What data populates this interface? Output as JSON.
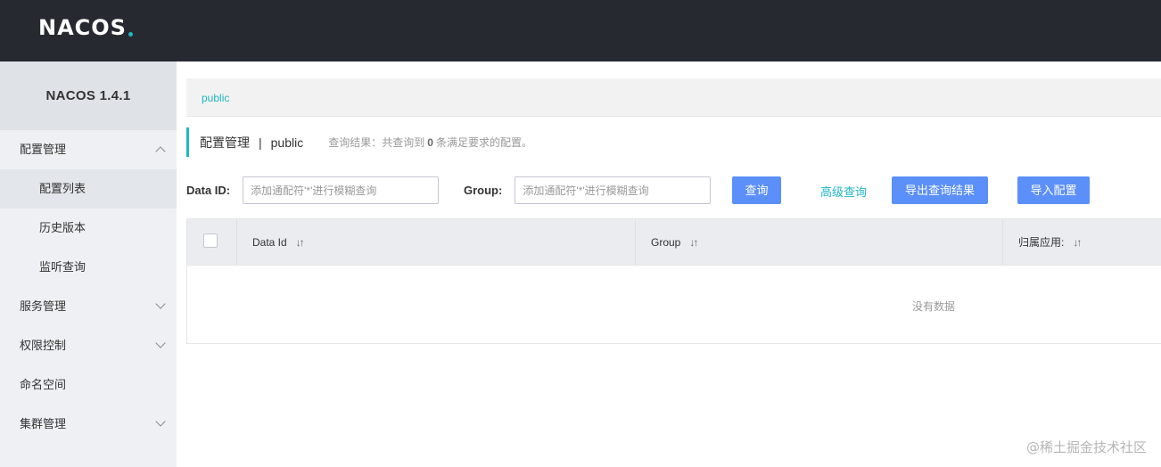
{
  "header": {
    "logo_text": "NACOS"
  },
  "sidebar": {
    "title": "NACOS 1.4.1",
    "items": [
      {
        "label": "配置管理"
      },
      {
        "label": "配置列表"
      },
      {
        "label": "历史版本"
      },
      {
        "label": "监听查询"
      },
      {
        "label": "服务管理"
      },
      {
        "label": "权限控制"
      },
      {
        "label": "命名空间"
      },
      {
        "label": "集群管理"
      }
    ]
  },
  "namespace": {
    "current": "public"
  },
  "page": {
    "title": "配置管理",
    "separator": "|",
    "namespace_name": "public",
    "result_prefix": "查询结果：共查询到",
    "result_count": "0",
    "result_suffix": "条满足要求的配置。"
  },
  "filters": {
    "data_id_label": "Data ID:",
    "data_id_placeholder": "添加通配符'*'进行模糊查询",
    "group_label": "Group:",
    "group_placeholder": "添加通配符'*'进行模糊查询"
  },
  "actions": {
    "query": "查询",
    "advanced_query": "高级查询",
    "export": "导出查询结果",
    "import": "导入配置"
  },
  "table": {
    "columns": [
      {
        "label": "Data Id"
      },
      {
        "label": "Group"
      },
      {
        "label": "归属应用:"
      }
    ],
    "sort_icon": "↓↑",
    "empty_text": "没有数据"
  },
  "watermark": "@稀土掘金技术社区",
  "colors": {
    "topbar": "#262a30",
    "accent": "#1fb6c5",
    "primary_button": "#5b8ff9"
  }
}
